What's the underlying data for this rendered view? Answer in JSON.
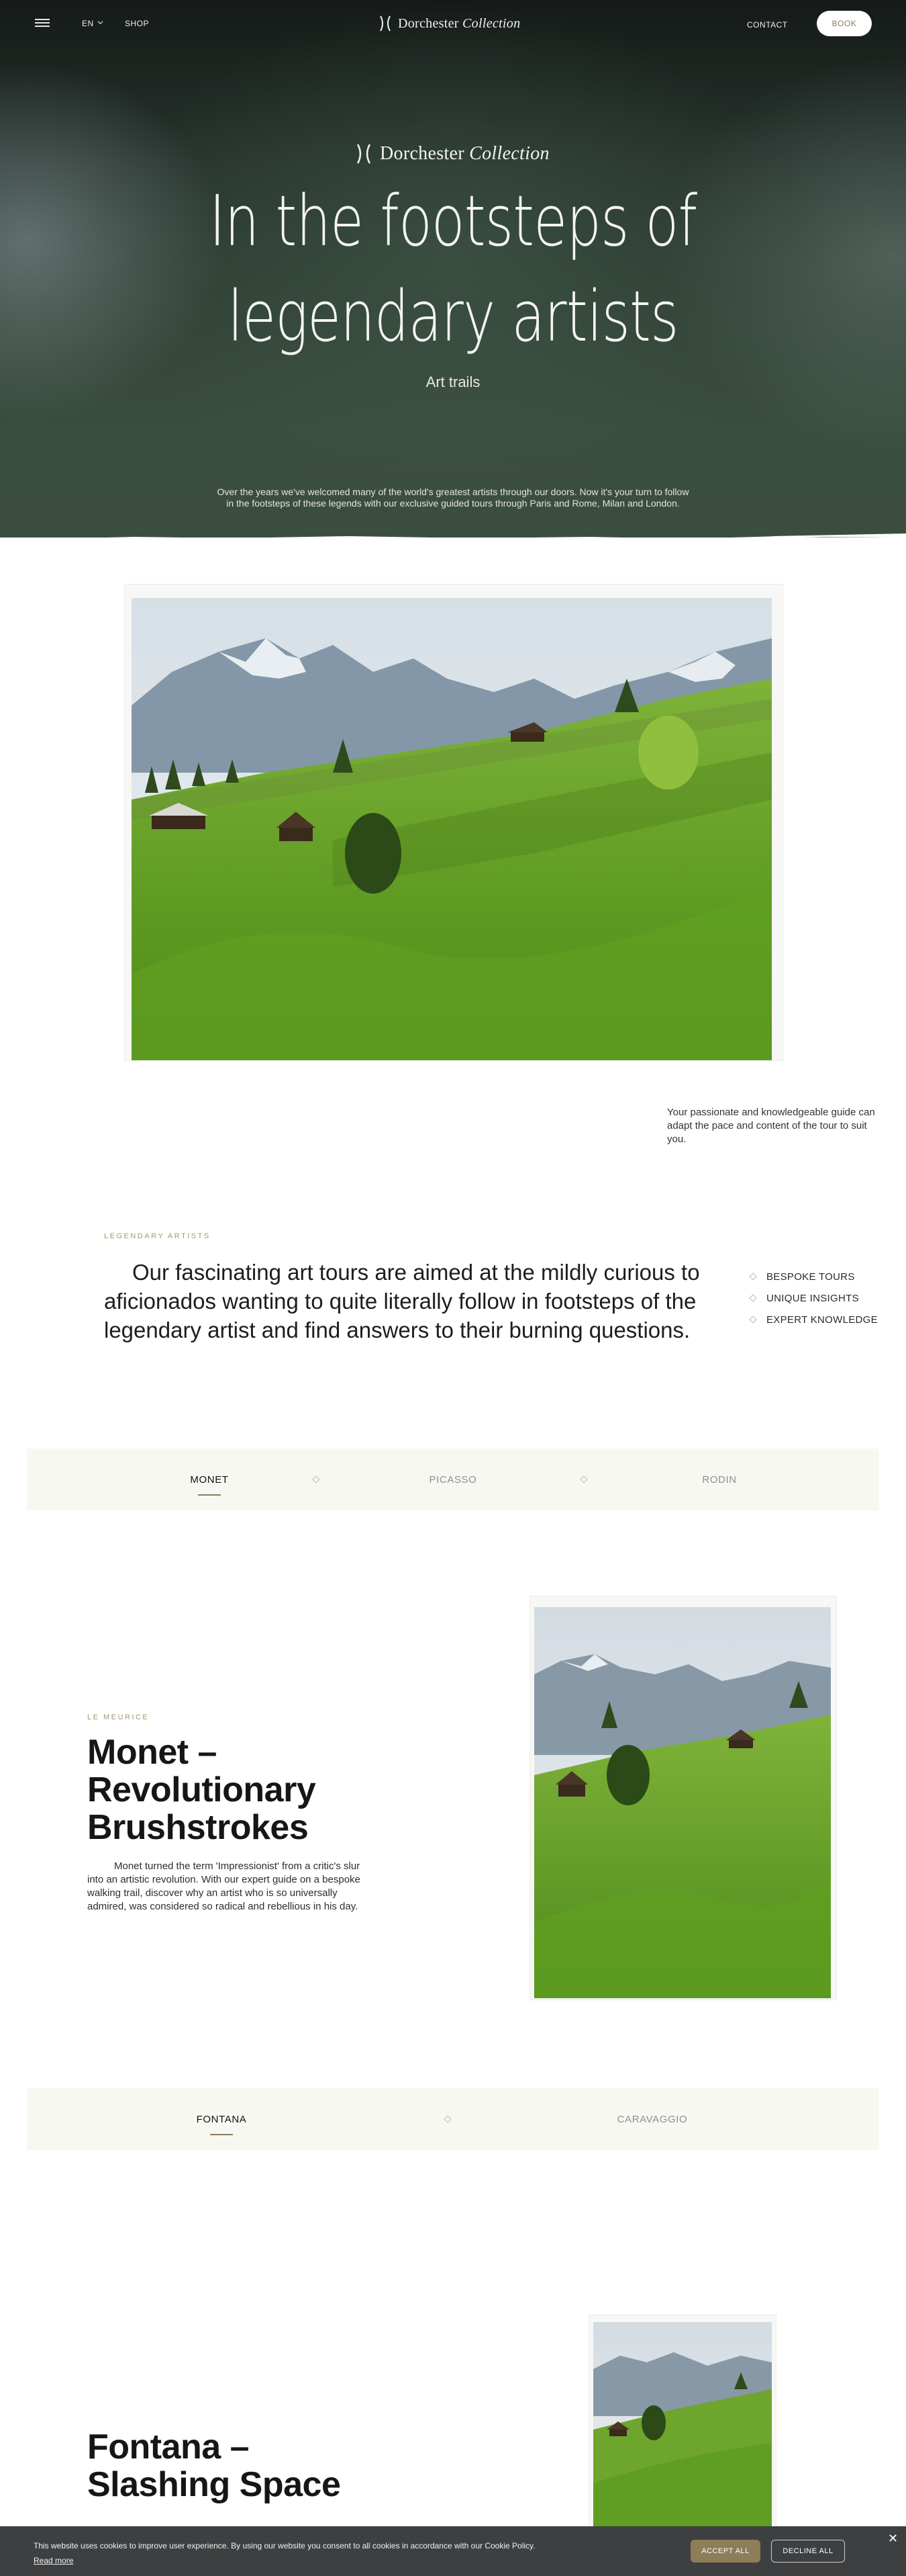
{
  "nav": {
    "language": "EN",
    "shop": "SHOP",
    "logo_main": "Dorchester",
    "logo_italic": "Collection",
    "contact": "CONTACT",
    "book": "BOOK"
  },
  "hero": {
    "logo_main": "Dorchester",
    "logo_italic": "Collection",
    "title_line1": "In the footsteps of",
    "title_line2": "legendary artists",
    "subtitle": "Art trails",
    "intro_line1": "Over the years we've welcomed many of the world's greatest artists through our doors. Now it's your turn to follow",
    "intro_line2": "in the footsteps of these legends with our exclusive guided tours through Paris and Rome, Milan and London."
  },
  "guide_caption": "Your passionate and knowledgeable guide can adapt the pace and content of the tour to suit you.",
  "intro": {
    "eyebrow": "LEGENDARY ARTISTS",
    "lead": "Our fascinating art tours are aimed at the mildly curious to aficionados wanting to quite literally follow in footsteps of the legendary artist and find answers to their burning questions.",
    "features": [
      "BESPOKE TOURS",
      "UNIQUE INSIGHTS",
      "EXPERT KNOWLEDGE"
    ]
  },
  "tabs1": {
    "items": [
      "MONET",
      "PICASSO",
      "RODIN"
    ],
    "active": "MONET"
  },
  "monet": {
    "eyebrow": "LE MEURICE",
    "title_line1": "Monet –",
    "title_line2": "Revolutionary",
    "title_line3": "Brushstrokes",
    "body": "Monet turned the term 'Impressionist' from a critic's slur into an artistic revolution. With our expert guide on a bespoke walking trail, discover why an artist who is so universally admired, was considered so radical and rebellious in his day."
  },
  "tabs2": {
    "items": [
      "FONTANA",
      "CARAVAGGIO"
    ],
    "active": "FONTANA"
  },
  "fontana": {
    "title_line1": "Fontana –",
    "title_line2": "Slashing Space"
  },
  "cookie": {
    "text": "This website uses cookies to improve user experience. By using our website you consent to all cookies in accordance with our Cookie Policy.",
    "read_more": "Read more",
    "accept": "ACCEPT ALL",
    "decline": "DECLINE ALL"
  },
  "colors": {
    "gold_accent": "#8a7d5a",
    "eyebrow": "#a49868",
    "tab_background": "#f8f8f2",
    "cookie_background": "#3d3f41"
  },
  "icons": [
    "menu-icon",
    "chevron-down-icon",
    "logo-mark-icon",
    "diamond-icon",
    "close-icon"
  ]
}
